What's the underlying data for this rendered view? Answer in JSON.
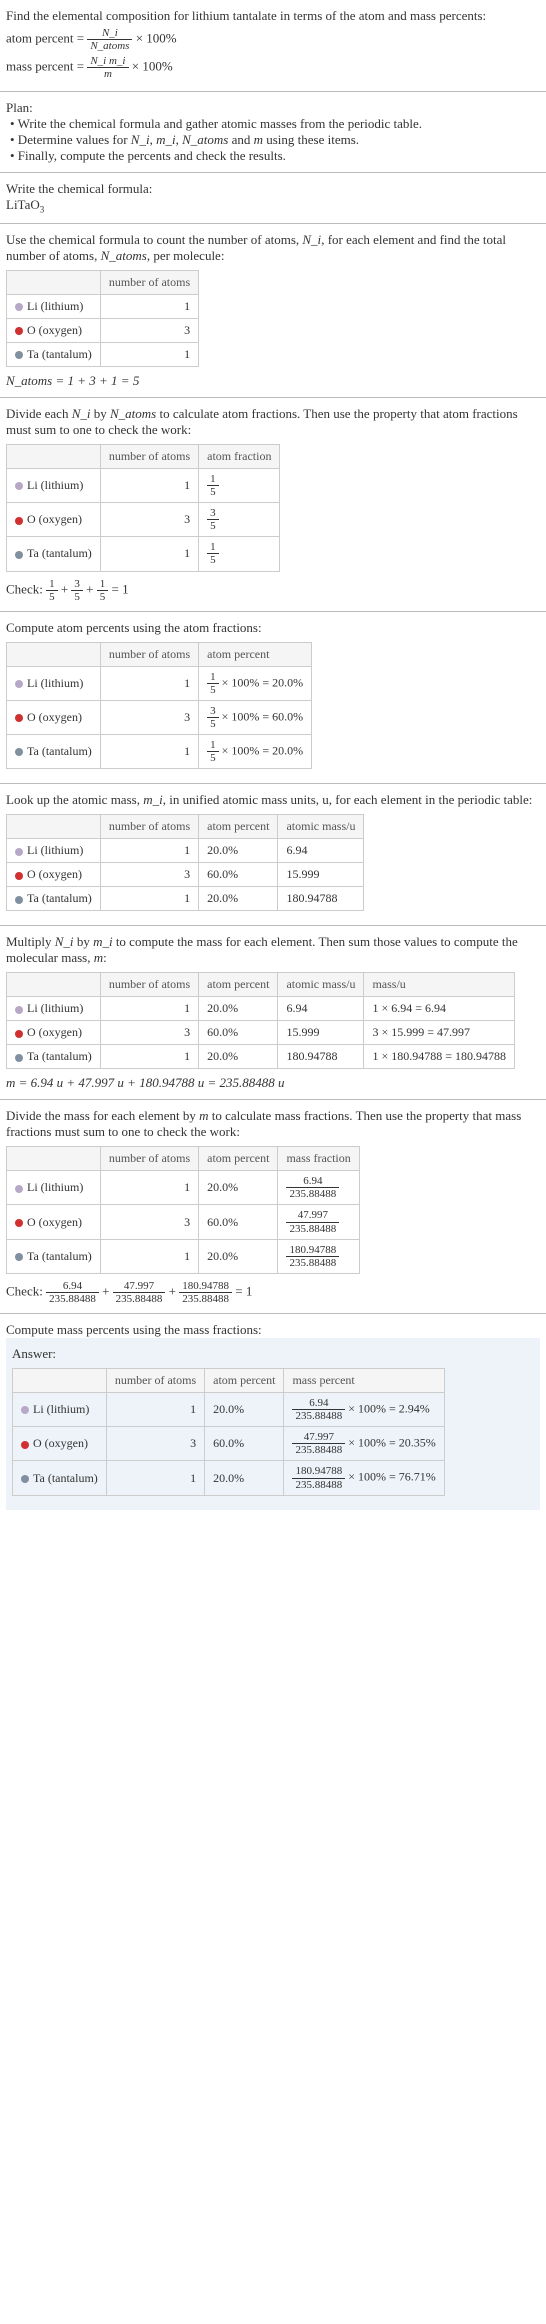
{
  "intro": {
    "line1": "Find the elemental composition for lithium tantalate in terms of the atom and mass percents:",
    "atom_percent_label": "atom percent = ",
    "atom_percent_frac_num": "N_i",
    "atom_percent_frac_den": "N_atoms",
    "times100": " × 100%",
    "mass_percent_label": "mass percent = ",
    "mass_percent_frac_num": "N_i m_i",
    "mass_percent_frac_den": "m"
  },
  "plan": {
    "title": "Plan:",
    "b1": "• Write the chemical formula and gather atomic masses from the periodic table.",
    "b2_a": "• Determine values for ",
    "b2_ni": "N_i",
    "b2_b": ", ",
    "b2_mi": "m_i",
    "b2_c": ", ",
    "b2_na": "N_atoms",
    "b2_d": " and ",
    "b2_m": "m",
    "b2_e": " using these items.",
    "b3": "• Finally, compute the percents and check the results."
  },
  "formula": {
    "title": "Write the chemical formula:",
    "text": "LiTaO",
    "sub": "3"
  },
  "count": {
    "intro_a": "Use the chemical formula to count the number of atoms, ",
    "intro_ni": "N_i",
    "intro_b": ", for each element and find the total number of atoms, ",
    "intro_na": "N_atoms",
    "intro_c": ", per molecule:",
    "col_blank": "",
    "col_natoms": "number of atoms",
    "li_label": "Li (lithium)",
    "li_n": "1",
    "o_label": "O (oxygen)",
    "o_n": "3",
    "ta_label": "Ta (tantalum)",
    "ta_n": "1",
    "sum": "N_atoms = 1 + 3 + 1 = 5"
  },
  "atomfrac": {
    "intro_a": "Divide each ",
    "intro_ni": "N_i",
    "intro_b": " by ",
    "intro_na": "N_atoms",
    "intro_c": " to calculate atom fractions. Then use the property that atom fractions must sum to one to check the work:",
    "col_frac": "atom fraction",
    "li_num": "1",
    "li_den": "5",
    "o_num": "3",
    "o_den": "5",
    "ta_num": "1",
    "ta_den": "5",
    "check": "Check: ",
    "eq": " = 1"
  },
  "atompct": {
    "intro": "Compute atom percents using the atom fractions:",
    "col_pct": "atom percent",
    "li_num": "1",
    "li_den": "5",
    "li_res": " × 100% = 20.0%",
    "o_num": "3",
    "o_den": "5",
    "o_res": " × 100% = 60.0%",
    "ta_num": "1",
    "ta_den": "5",
    "ta_res": " × 100% = 20.0%"
  },
  "mass": {
    "intro_a": "Look up the atomic mass, ",
    "intro_mi": "m_i",
    "intro_b": ", in unified atomic mass units, u, for each element in the periodic table:",
    "col_mass": "atomic mass/u",
    "li_pct": "20.0%",
    "li_mass": "6.94",
    "o_pct": "60.0%",
    "o_mass": "15.999",
    "ta_pct": "20.0%",
    "ta_mass": "180.94788"
  },
  "massmul": {
    "intro_a": "Multiply ",
    "intro_ni": "N_i",
    "intro_b": " by ",
    "intro_mi": "m_i",
    "intro_c": " to compute the mass for each element. Then sum those values to compute the molecular mass, ",
    "intro_m": "m",
    "intro_d": ":",
    "col_massu": "mass/u",
    "li_calc": "1 × 6.94 = 6.94",
    "o_calc": "3 × 15.999 = 47.997",
    "ta_calc": "1 × 180.94788 = 180.94788",
    "sum": "m = 6.94 u + 47.997 u + 180.94788 u = 235.88488 u"
  },
  "massfrac": {
    "intro_a": "Divide the mass for each element by ",
    "intro_m": "m",
    "intro_b": " to calculate mass fractions. Then use the property that mass fractions must sum to one to check the work:",
    "col_mfrac": "mass fraction",
    "li_num": "6.94",
    "li_den": "235.88488",
    "o_num": "47.997",
    "o_den": "235.88488",
    "ta_num": "180.94788",
    "ta_den": "235.88488",
    "check": "Check: ",
    "eq": " = 1"
  },
  "masspct": {
    "intro": "Compute mass percents using the mass fractions:",
    "answer": "Answer:",
    "col_mpct": "mass percent",
    "li_num": "6.94",
    "li_den": "235.88488",
    "li_res": " × 100% = 2.94%",
    "o_num": "47.997",
    "o_den": "235.88488",
    "o_res": " × 100% = 20.35%",
    "ta_num": "180.94788",
    "ta_den": "235.88488",
    "ta_res": " × 100% = 76.71%"
  }
}
